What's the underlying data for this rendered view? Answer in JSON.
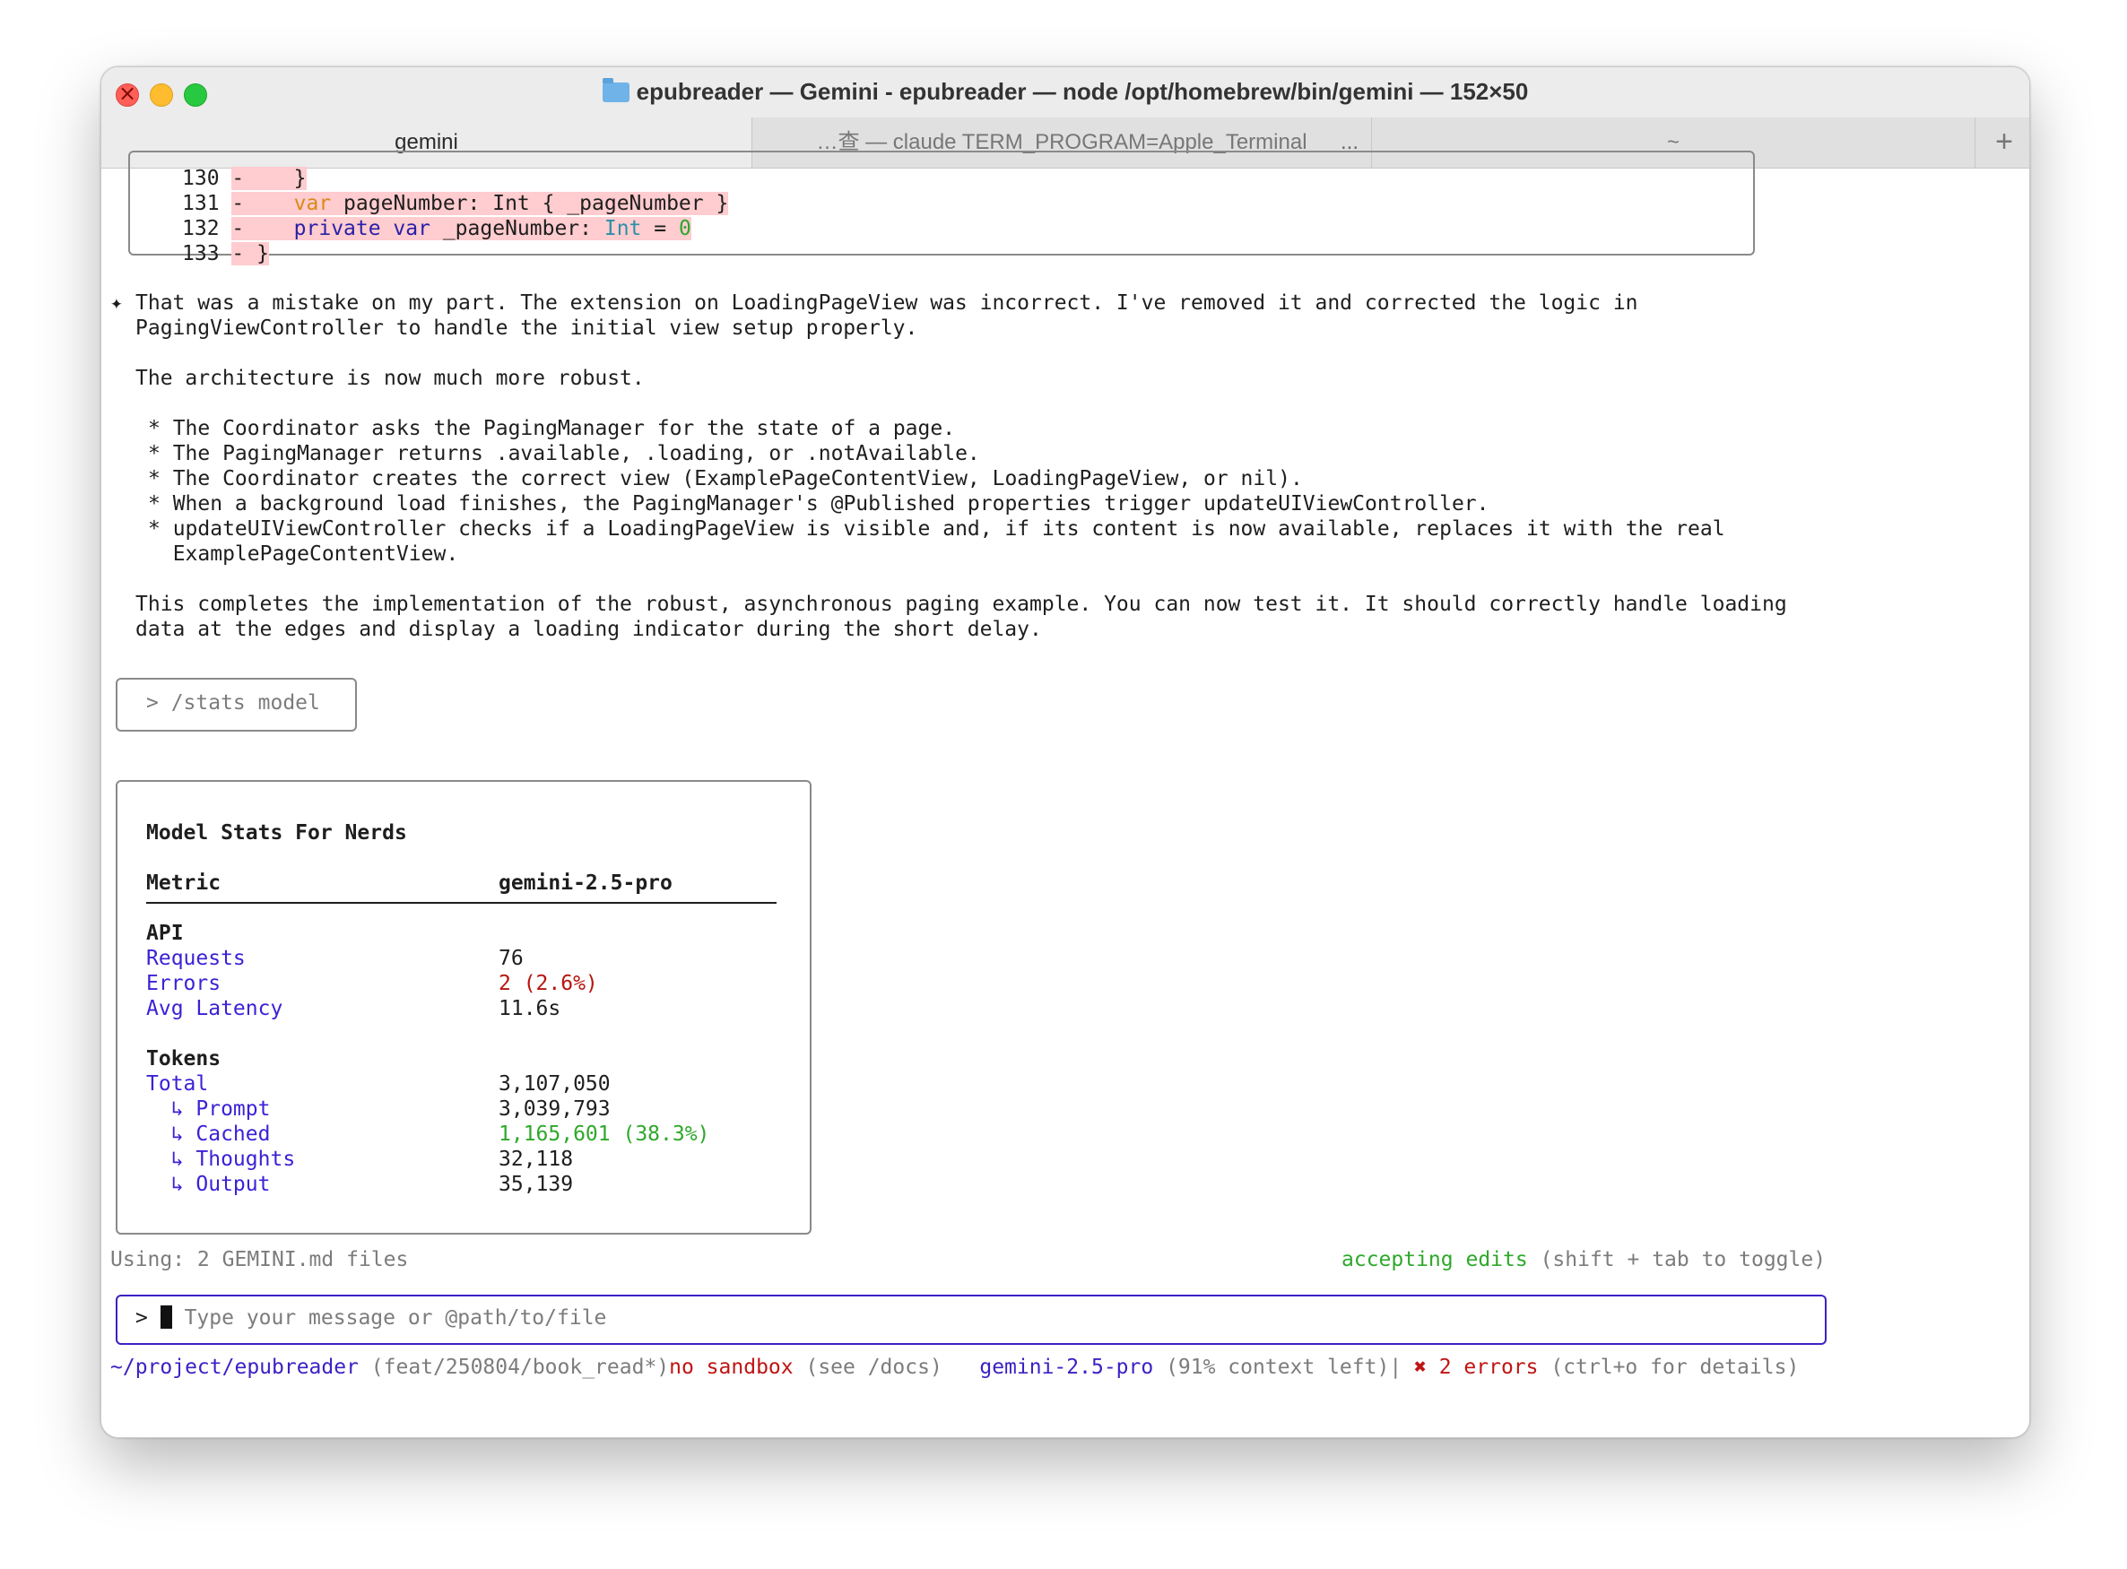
{
  "window": {
    "title": "epubreader — Gemini - epubreader — node /opt/homebrew/bin/gemini — 152×50"
  },
  "tabs": [
    {
      "label": "gemini",
      "active": true
    },
    {
      "label": "…查 — claude TERM_PROGRAM=Apple_Terminal",
      "more": "...",
      "active": false
    },
    {
      "label": "~",
      "active": false
    }
  ],
  "new_tab_label": "+",
  "diff": {
    "lines": [
      {
        "num": "130",
        "sign": "-",
        "code": "    }"
      },
      {
        "num": "131",
        "sign": "-",
        "pre": "    ",
        "kw": "var",
        "rest": " pageNumber: Int { _pageNumber }"
      },
      {
        "num": "132",
        "sign": "-",
        "pre": "    ",
        "kw": "private var",
        "mid": " _pageNumber: ",
        "type": "Int",
        "eq": " = ",
        "val": "0"
      },
      {
        "num": "133",
        "sign": "-",
        "code": " }"
      }
    ]
  },
  "response": {
    "marker": "✦",
    "para1_line1": "That was a mistake on my part. The extension on LoadingPageView was incorrect. I've removed it and corrected the logic in",
    "para1_line2": "PagingViewController to handle the initial view setup properly.",
    "para2": "The architecture is now much more robust.",
    "bullets": [
      "* The Coordinator asks the PagingManager for the state of a page.",
      "* The PagingManager returns .available, .loading, or .notAvailable.",
      "* The Coordinator creates the correct view (ExamplePageContentView, LoadingPageView, or nil).",
      "* When a background load finishes, the PagingManager's @Published properties trigger updateUIViewController.",
      "* updateUIViewController checks if a LoadingPageView is visible and, if its content is now available, replaces it with the real",
      "  ExamplePageContentView."
    ],
    "para3_line1": "This completes the implementation of the robust, asynchronous paging example. You can now test it. It should correctly handle loading",
    "para3_line2": "data at the edges and display a loading indicator during the short delay."
  },
  "command": "> /stats model",
  "stats": {
    "title": "Model Stats For Nerds",
    "col_metric": "Metric",
    "col_model": "gemini-2.5-pro",
    "api_heading": "API",
    "api_rows": [
      {
        "label": "Requests",
        "value": "76"
      },
      {
        "label": "Errors",
        "value": "2 (2.6%)"
      },
      {
        "label": "Avg Latency",
        "value": "11.6s"
      }
    ],
    "tokens_heading": "Tokens",
    "token_rows": [
      {
        "label": "Total",
        "value": "3,107,050"
      },
      {
        "label": "  ↳ Prompt",
        "value": "3,039,793"
      },
      {
        "label": "  ↳ Cached",
        "value": "1,165,601 (38.3%)"
      },
      {
        "label": "  ↳ Thoughts",
        "value": "32,118"
      },
      {
        "label": "  ↳ Output",
        "value": "35,139"
      }
    ]
  },
  "status": {
    "using": "Using: 2 GEMINI.md files",
    "accepting": "accepting edits",
    "toggle_hint": " (shift + tab to toggle)"
  },
  "input": {
    "prompt": ">",
    "placeholder": "Type your message or @path/to/file"
  },
  "footer": {
    "path": "~/project/epubreader",
    "branch": " (feat/250804/book_read*)",
    "sandbox": "no sandbox",
    "sandbox_hint": " (see /docs)",
    "model": "gemini-2.5-pro",
    "context": " (91% context left)| ",
    "errors": "✖ 2 errors",
    "errors_hint": " (ctrl+o for details)"
  },
  "colors": {
    "deleted_bg": "#ffcccf",
    "metric_purple": "#3a22d6",
    "error_red": "#b6140f",
    "cached_green": "#2ea82b"
  }
}
